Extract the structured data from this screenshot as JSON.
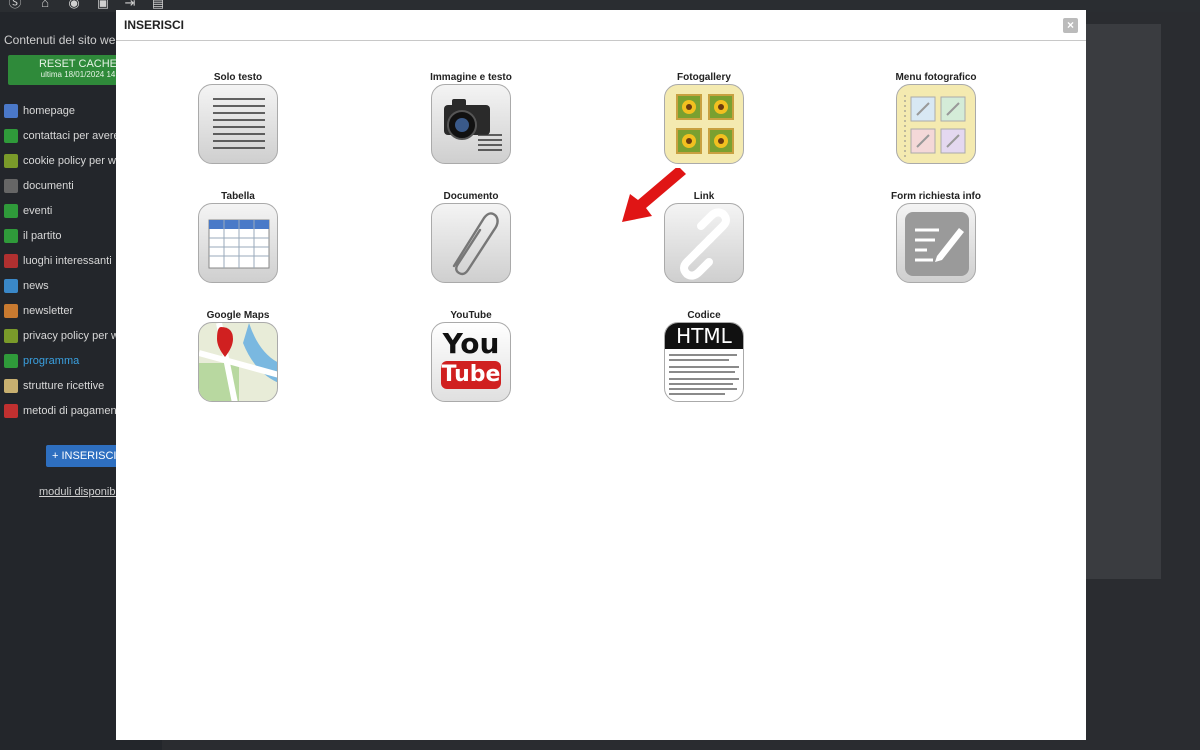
{
  "topbar": {
    "icons": [
      "logo-icon",
      "home-icon",
      "eye-icon",
      "user-icon",
      "login-icon",
      "page-icon"
    ]
  },
  "sidebar": {
    "title": "Contenuti del sito web",
    "reset_label": "RESET CACHE",
    "reset_sub": "ultima 18/01/2024 14",
    "items": [
      {
        "label": "homepage",
        "icon": "home-icon",
        "color": "#4a78c8"
      },
      {
        "label": "contattaci per avere",
        "icon": "page-icon",
        "color": "#2f9a3a"
      },
      {
        "label": "cookie policy per ww",
        "icon": "page-icon",
        "color": "#7a9a2a"
      },
      {
        "label": "documenti",
        "icon": "folder-icon",
        "color": "#666666"
      },
      {
        "label": "eventi",
        "icon": "calendar-icon",
        "color": "#2f9a3a"
      },
      {
        "label": "il partito",
        "icon": "page-icon",
        "color": "#2f9a3a"
      },
      {
        "label": "luoghi interessanti",
        "icon": "map-pin-icon",
        "color": "#b03030"
      },
      {
        "label": "news",
        "icon": "news-icon",
        "color": "#3a88c8"
      },
      {
        "label": "newsletter",
        "icon": "newsletter-icon",
        "color": "#c87a30"
      },
      {
        "label": "privacy policy per w",
        "icon": "page-icon",
        "color": "#7a9a2a"
      },
      {
        "label": "programma",
        "icon": "page-icon",
        "color": "#2f9a3a",
        "active": true
      },
      {
        "label": "strutture ricettive",
        "icon": "hotel-icon",
        "color": "#c8b070"
      },
      {
        "label": "metodi di pagament",
        "icon": "payment-icon",
        "color": "#c03030"
      }
    ],
    "insert_label": "+ INSERISCI",
    "moduli_label": "moduli disponibi"
  },
  "modal": {
    "title": "INSERISCI",
    "close": "×",
    "tiles": [
      {
        "label": "Solo testo",
        "icon": "text-lines-icon"
      },
      {
        "label": "Immagine e testo",
        "icon": "camera-icon"
      },
      {
        "label": "Fotogallery",
        "icon": "photo-gallery-icon"
      },
      {
        "label": "Menu fotografico",
        "icon": "photo-menu-icon"
      },
      {
        "label": "Tabella",
        "icon": "table-icon"
      },
      {
        "label": "Documento",
        "icon": "paperclip-icon"
      },
      {
        "label": "Link",
        "icon": "link-icon"
      },
      {
        "label": "Form richiesta info",
        "icon": "form-icon"
      },
      {
        "label": "Google Maps",
        "icon": "map-icon"
      },
      {
        "label": "YouTube",
        "icon": "youtube-icon",
        "text1": "You",
        "text2": "Tube"
      },
      {
        "label": "Codice",
        "icon": "code-icon",
        "text1": "HTML"
      }
    ]
  }
}
